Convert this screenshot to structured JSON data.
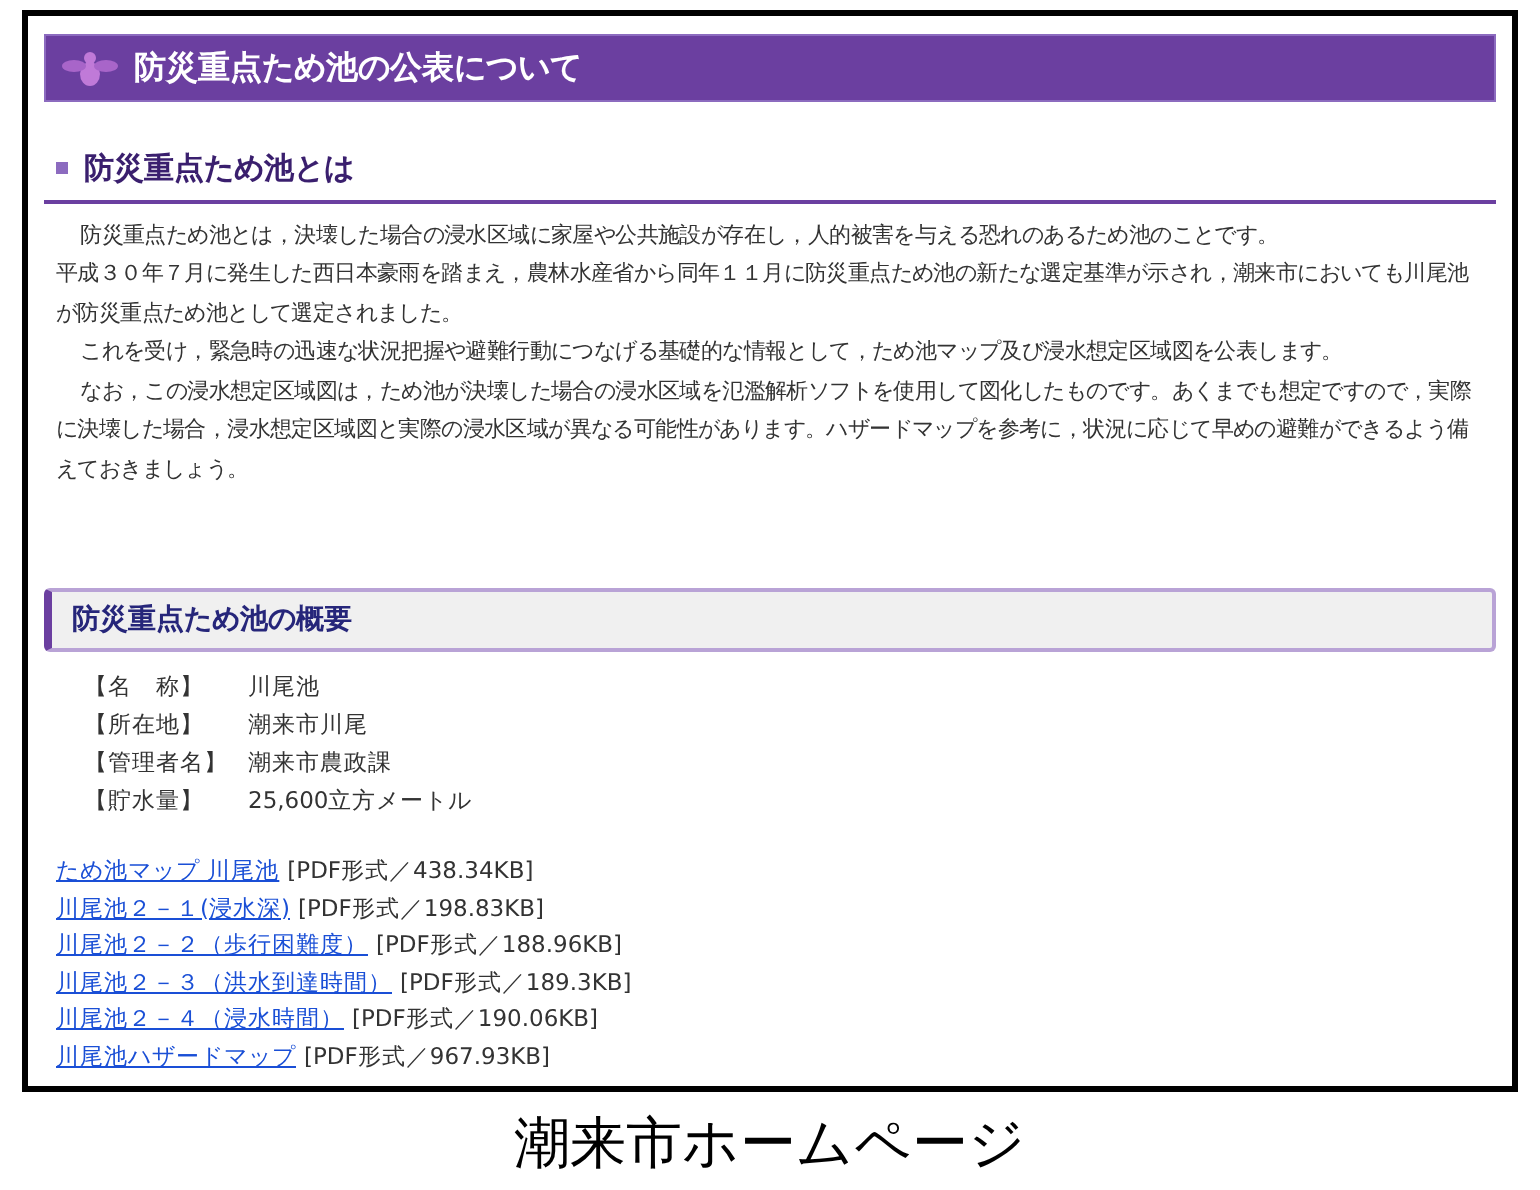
{
  "page_title": "防災重点ため池の公表について",
  "section_1": {
    "heading": "防災重点ため池とは",
    "paragraphs": [
      {
        "text": "防災重点ため池とは，決壊した場合の浸水区域に家屋や公共施設が存在し，人的被害を与える恐れのあるため池のことです。",
        "indent": true
      },
      {
        "text": "平成３０年７月に発生した西日本豪雨を踏まえ，農林水産省から同年１１月に防災重点ため池の新たな選定基準が示され，潮来市においても川尾池が防災重点ため池として選定されました。",
        "indent": false
      },
      {
        "text": "これを受け，緊急時の迅速な状況把握や避難行動につなげる基礎的な情報として，ため池マップ及び浸水想定区域図を公表します。",
        "indent": true
      },
      {
        "text": "なお，この浸水想定区域図は，ため池が決壊した場合の浸水区域を氾濫解析ソフトを使用して図化したものです。あくまでも想定ですので，実際に決壊した場合，浸水想定区域図と実際の浸水区域が異なる可能性があります。ハザードマップを参考に，状況に応じて早めの避難ができるよう備えておきましょう。",
        "indent": true
      }
    ]
  },
  "section_2": {
    "heading": "防災重点ため池の概要",
    "details": [
      {
        "label": "【名　称】",
        "value": "川尾池"
      },
      {
        "label": "【所在地】",
        "value": "潮来市川尾"
      },
      {
        "label": "【管理者名】",
        "value": "潮来市農政課"
      },
      {
        "label": "【貯水量】",
        "value": "25,600立方メートル"
      }
    ],
    "files": [
      {
        "link": "ため池マップ 川尾池",
        "info": "[PDF形式／438.34KB]"
      },
      {
        "link": "川尾池２－１(浸水深)",
        "info": "[PDF形式／198.83KB]"
      },
      {
        "link": "川尾池２－２（歩行困難度）",
        "info": "[PDF形式／188.96KB]"
      },
      {
        "link": "川尾池２－３（洪水到達時間）",
        "info": "[PDF形式／189.3KB]"
      },
      {
        "link": "川尾池２－４（浸水時間）",
        "info": "[PDF形式／190.06KB]"
      },
      {
        "link": "川尾池ハザードマップ",
        "info": "[PDF形式／967.93KB]"
      }
    ]
  },
  "caption": "潮来市ホームページ"
}
